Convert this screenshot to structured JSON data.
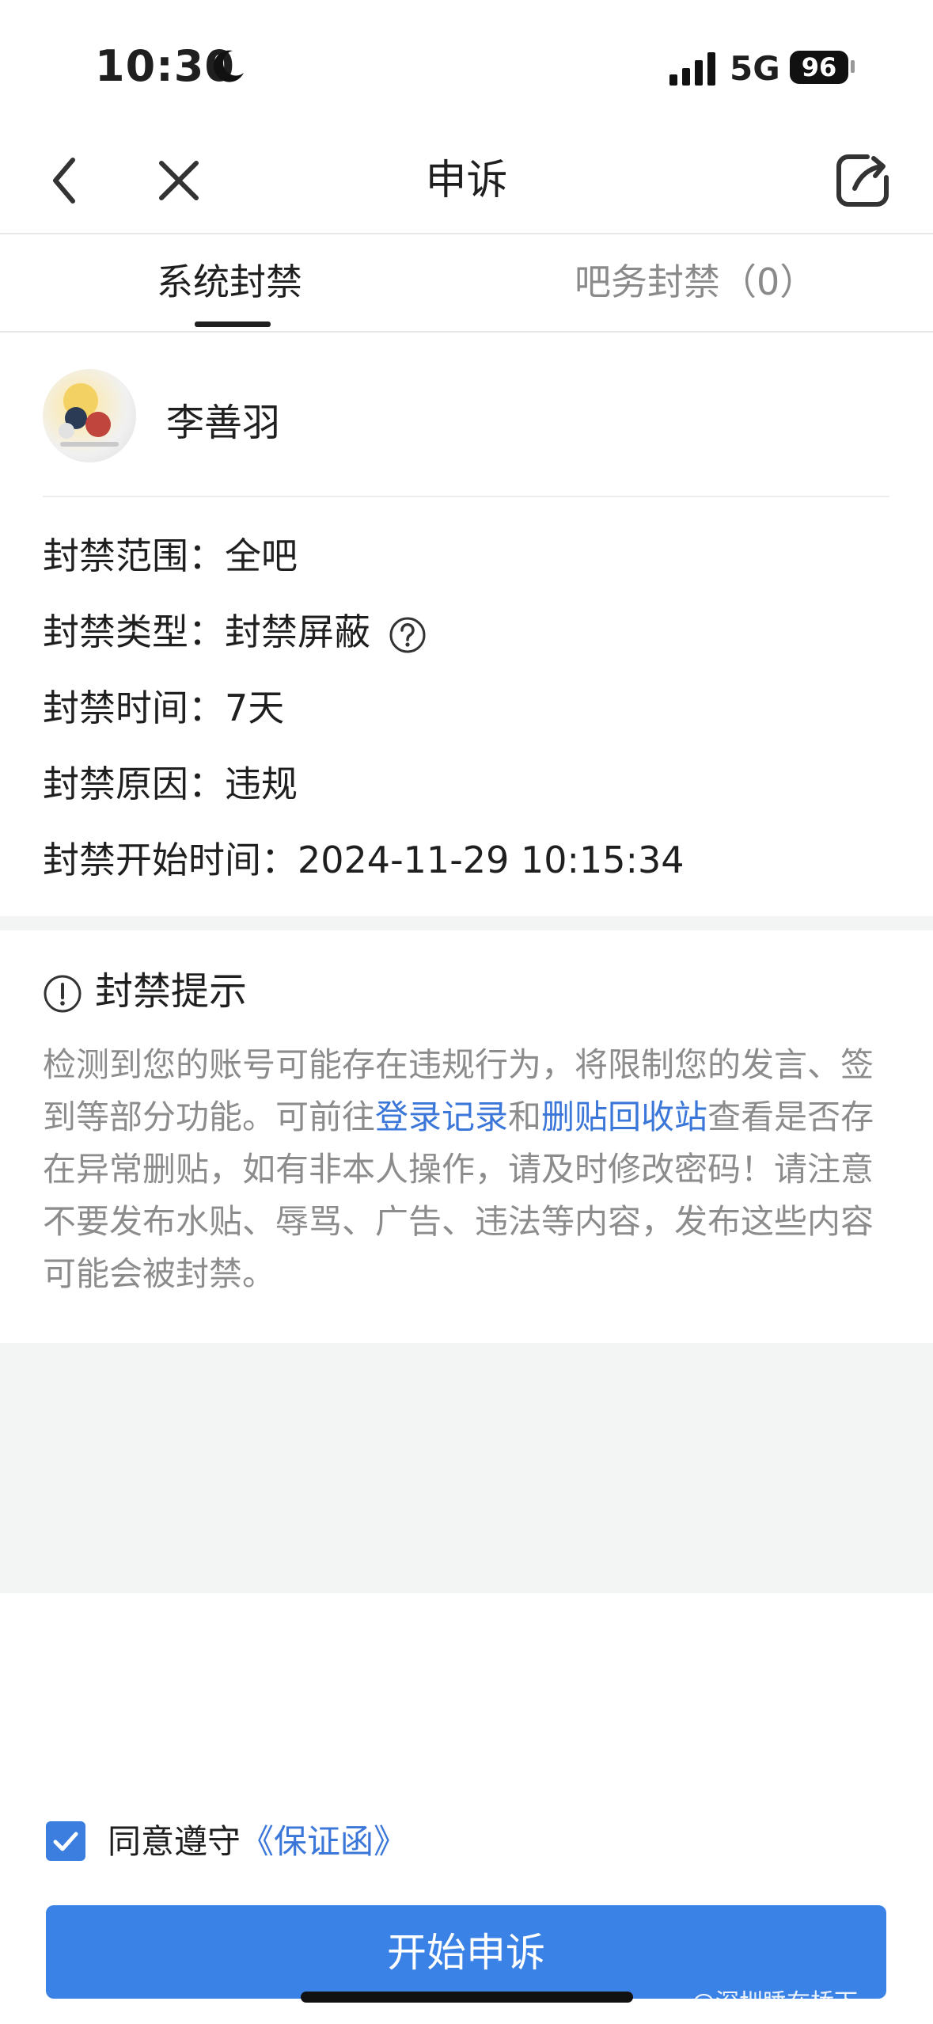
{
  "status_bar": {
    "time": "10:30",
    "network": "5G",
    "battery": "96"
  },
  "nav": {
    "title": "申诉"
  },
  "tabs": {
    "active": "系统封禁",
    "inactive": "吧务封禁（0）"
  },
  "profile": {
    "username": "李善羽"
  },
  "details": {
    "scope_label": "封禁范围：",
    "scope_value": "全吧",
    "type_label": "封禁类型：",
    "type_value": "封禁屏蔽",
    "duration_label": "封禁时间：",
    "duration_value": "7天",
    "reason_label": "封禁原因：",
    "reason_value": "违规",
    "start_label": "封禁开始时间：",
    "start_value": "2024-11-29 10:15:34"
  },
  "notice": {
    "title": "封禁提示",
    "text_1": "检测到您的账号可能存在违规行为，将限制您的发言、签到等部分功能。可前往",
    "link_1": "登录记录",
    "text_2": "和",
    "link_2": "删贴回收站",
    "text_3": "查看是否存在异常删贴，如有非本人操作，请及时修改密码！请注意不要发布水贴、辱骂、广告、违法等内容，发布这些内容可能会被封禁。"
  },
  "agreement": {
    "label": "同意遵守",
    "link": "《保证函》",
    "checked": true
  },
  "submit": {
    "label": "开始申诉"
  },
  "watermark": "@深圳睡在桥下",
  "colors": {
    "accent": "#3b82e6",
    "link": "#3b76d9",
    "muted_text": "#8c8c8c"
  }
}
